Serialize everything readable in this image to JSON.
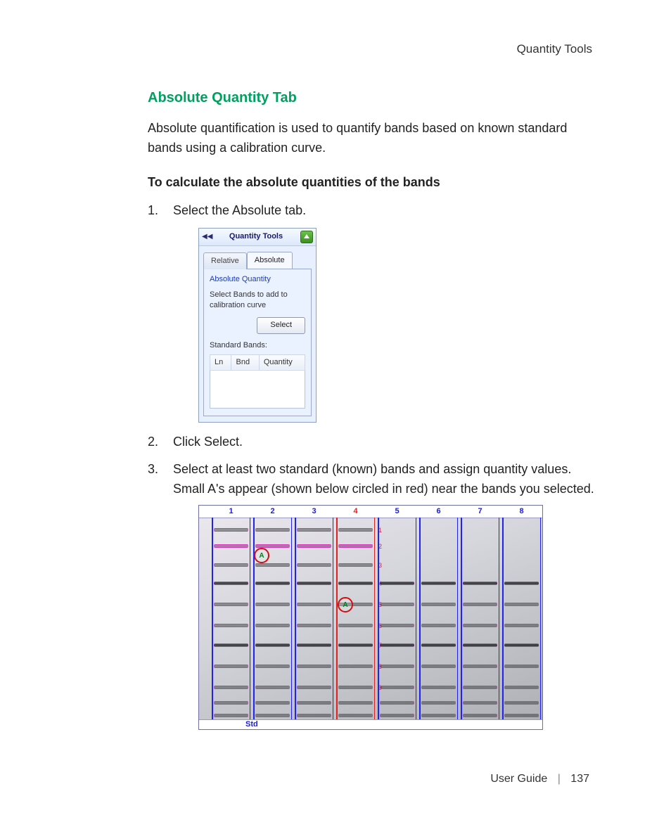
{
  "running_head": "Quantity Tools",
  "section_title": "Absolute Quantity Tab",
  "intro": "Absolute quantification is used to quantify bands based on known standard bands using a calibration curve.",
  "subhead": "To calculate the absolute quantities of the bands",
  "steps": {
    "s1": "Select the Absolute tab.",
    "s2": "Click Select.",
    "s3": "Select at least two standard (known) bands and assign quantity values. Small A's appear (shown below circled in red) near the bands you selected."
  },
  "panel": {
    "title": "Quantity Tools",
    "tab_relative": "Relative",
    "tab_absolute": "Absolute",
    "group_label": "Absolute Quantity",
    "help_text": "Select Bands to add to calibration curve",
    "select_btn": "Select",
    "std_label": "Standard Bands:",
    "col_ln": "Ln",
    "col_bnd": "Bnd",
    "col_qty": "Quantity"
  },
  "gel": {
    "lanes": [
      "1",
      "2",
      "3",
      "4",
      "5",
      "6",
      "7",
      "8"
    ],
    "selected_lane_index": 3,
    "std_label": "Std",
    "marker_letter": "A",
    "band_labels": [
      "1",
      "2",
      "3",
      "4",
      "5",
      "6",
      "7",
      "8",
      "9"
    ]
  },
  "footer": {
    "doc": "User Guide",
    "page": "137"
  }
}
